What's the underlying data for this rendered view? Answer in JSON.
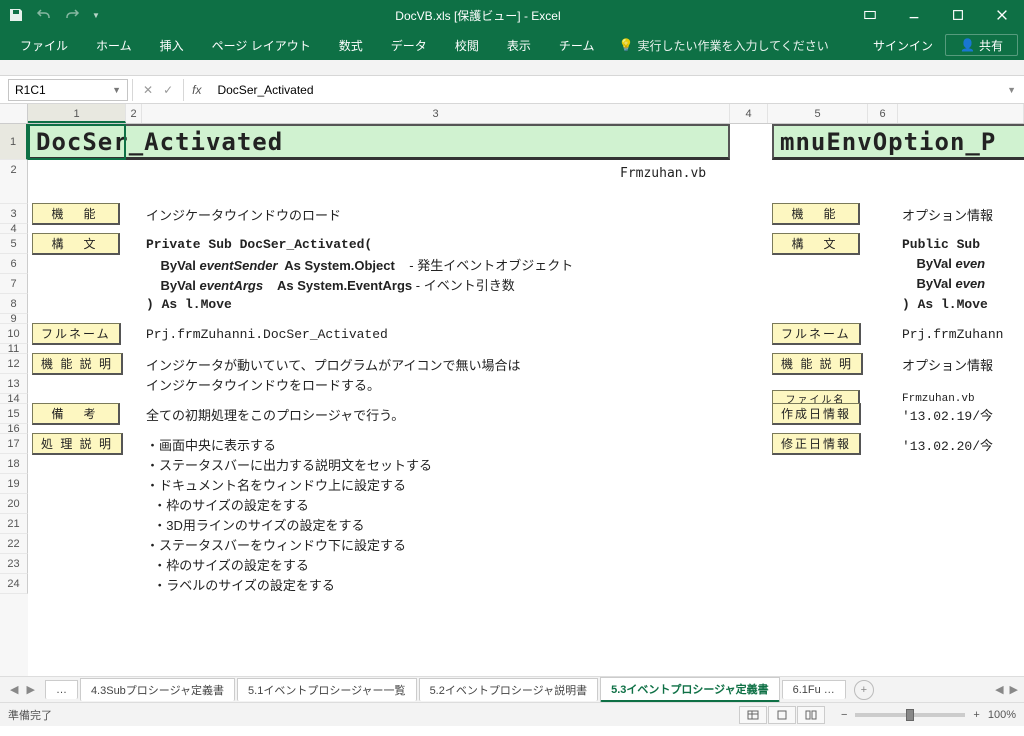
{
  "titlebar": {
    "title": "DocVB.xls  [保護ビュー] - Excel"
  },
  "ribbon": {
    "tabs": [
      "ファイル",
      "ホーム",
      "挿入",
      "ページ レイアウト",
      "数式",
      "データ",
      "校閲",
      "表示",
      "チーム"
    ],
    "tellme": "実行したい作業を入力してください",
    "signin": "サインイン",
    "share": "共有"
  },
  "namebox": "R1C1",
  "formula": "DocSer_Activated",
  "cols": [
    "1",
    "2",
    "3",
    "4",
    "5",
    "6"
  ],
  "rows": [
    "1",
    "2",
    "3",
    "4",
    "5",
    "6",
    "7",
    "8",
    "9",
    "10",
    "11",
    "12",
    "13",
    "14",
    "15",
    "16",
    "17",
    "18",
    "19",
    "20",
    "21",
    "22",
    "23",
    "24"
  ],
  "titleA": "DocSer_Activated",
  "titleB": "mnuEnvOption_P",
  "file_label": "Frmzuhan.vb",
  "labels": {
    "kinou": "機　能",
    "koubun": "構　文",
    "fullname": "フルネーム",
    "kinousetsumei": "機 能 説 明",
    "bikou": "備　考",
    "shori": "処 理 説 明",
    "filename": "ファイル名",
    "sakusei": "作成日情報",
    "shusei": "修正日情報"
  },
  "body": {
    "r3": "インジケータウインドウのロード",
    "r3b": "オプション情報",
    "r5": "Private Sub DocSer_Activated(",
    "r5b": "Public Sub ",
    "r6a": "    ByVal ",
    "r6b": "eventSender",
    "r6c": "  As System.Object    ",
    "r6d": "- 発生イベントオブジェクト",
    "r6e": "    ByVal ",
    "r6f": "even",
    "r7a": "    ByVal ",
    "r7b": "eventArgs",
    "r7c": "    As System.EventArgs ",
    "r7d": "- イベント引き数",
    "r7e": "    ByVal ",
    "r7f": "even",
    "r8": ") As l.Move",
    "r8b": ") As l.Move",
    "r10": "Prj.frmZuhanni.DocSer_Activated",
    "r10b": "Prj.frmZuhann",
    "r12": "インジケータが動いていて、プログラムがアイコンで無い場合は",
    "r12b": "オプション情報",
    "r13": "インジケータウインドウをロードする。",
    "r14b": "Frmzuhan.vb",
    "r15": "全ての初期処理をこのプロシージャで行う。",
    "r15b": "'13.02.19/今",
    "r17": "・画面中央に表示する",
    "r17b": "'13.02.20/今",
    "r18": "・ステータスバーに出力する説明文をセットする",
    "r19": "・ドキュメント名をウィンドウ上に設定する",
    "r20": "  ・枠のサイズの設定をする",
    "r21": "  ・3D用ラインのサイズの設定をする",
    "r22": "・ステータスバーをウィンドウ下に設定する",
    "r23": "  ・枠のサイズの設定をする",
    "r24": "  ・ラベルのサイズの設定をする"
  },
  "sheets": {
    "dots": "…",
    "s1": "4.3Subプロシージャ定義書",
    "s2": "5.1イベントプロシージャー一覧",
    "s3": "5.2イベントプロシージャ説明書",
    "s4": "5.3イベントプロシージャ定義書",
    "s5": "6.1Fu …"
  },
  "status": {
    "ready": "準備完了",
    "zoom": "100%"
  }
}
